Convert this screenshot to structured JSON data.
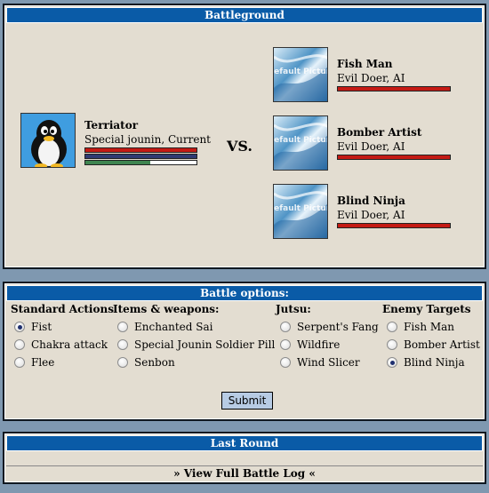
{
  "battleground": {
    "title": "Battleground",
    "vs": "VS.",
    "player": {
      "name": "Terriator",
      "rank": "Special jounin, Current",
      "health_fraction": 1.0,
      "chakra_fraction": 1.0,
      "stamina_fraction": 0.58,
      "colors": {
        "health": "#c41a14",
        "chakra": "#2f3a73",
        "stamina": "#3f8550"
      },
      "avatar_icon": "penguin-avatar-icon"
    },
    "enemies": [
      {
        "name": "Fish Man",
        "type": "Evil Doer, AI",
        "health_fraction": 1.0,
        "avatar_icon": "default-picture-icon",
        "avatar_text": "Default Picture"
      },
      {
        "name": "Bomber Artist",
        "type": "Evil Doer, AI",
        "health_fraction": 1.0,
        "avatar_icon": "default-picture-icon",
        "avatar_text": "Default Picture"
      },
      {
        "name": "Blind Ninja",
        "type": "Evil Doer, AI",
        "health_fraction": 1.0,
        "avatar_icon": "default-picture-icon",
        "avatar_text": "Default Picture"
      }
    ]
  },
  "battle_options": {
    "title": "Battle options:",
    "columns": [
      {
        "heading": "Standard Actions",
        "options": [
          "Fist",
          "Chakra attack",
          "Flee"
        ],
        "selected": "Fist"
      },
      {
        "heading": "Items & weapons:",
        "options": [
          "Enchanted Sai",
          "Special Jounin Soldier Pill",
          "Senbon"
        ],
        "selected": ""
      },
      {
        "heading": "Jutsu:",
        "options": [
          "Serpent's Fang",
          "Wildfire",
          "Wind Slicer"
        ],
        "selected": ""
      },
      {
        "heading": "Enemy Targets",
        "options": [
          "Fish Man",
          "Bomber Artist",
          "Blind Ninja"
        ],
        "selected": "Blind Ninja"
      }
    ],
    "submit_label": "Submit"
  },
  "last_round": {
    "title": "Last Round",
    "content": "",
    "log_link": "» View Full Battle Log «"
  },
  "theme": {
    "background": "#7f98b0",
    "panel": "#e3ddd1",
    "header": "#0a5ba7",
    "button": "#b7cbe4"
  }
}
